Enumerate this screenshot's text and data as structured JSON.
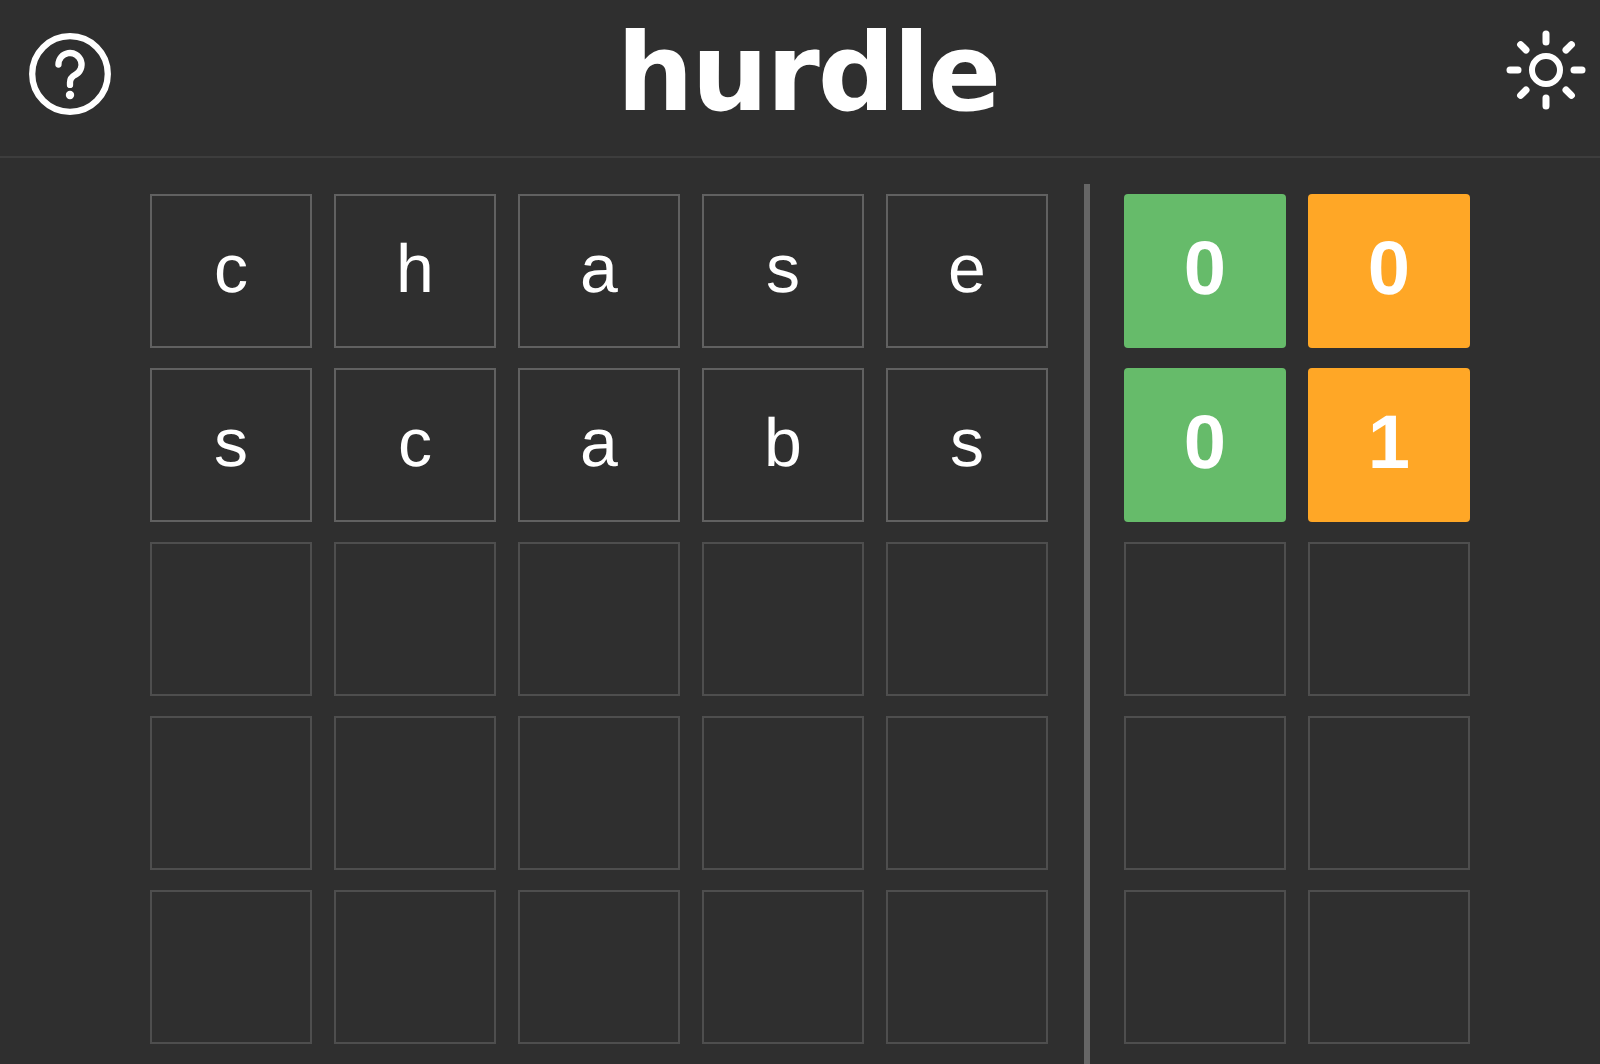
{
  "header": {
    "title": "hurdle"
  },
  "rows": [
    {
      "tiles": [
        {
          "filled": true,
          "letter": "c"
        },
        {
          "filled": true,
          "letter": "h"
        },
        {
          "filled": true,
          "letter": "a"
        },
        {
          "filled": true,
          "letter": "s"
        },
        {
          "filled": true,
          "letter": "e"
        }
      ],
      "scores": [
        {
          "filled": true,
          "kind": "correct",
          "value": "0"
        },
        {
          "filled": true,
          "kind": "present",
          "value": "0"
        }
      ]
    },
    {
      "tiles": [
        {
          "filled": true,
          "letter": "s"
        },
        {
          "filled": true,
          "letter": "c"
        },
        {
          "filled": true,
          "letter": "a"
        },
        {
          "filled": true,
          "letter": "b"
        },
        {
          "filled": true,
          "letter": "s"
        }
      ],
      "scores": [
        {
          "filled": true,
          "kind": "correct",
          "value": "0"
        },
        {
          "filled": true,
          "kind": "present",
          "value": "1"
        }
      ]
    },
    {
      "tiles": [
        {
          "filled": false
        },
        {
          "filled": false
        },
        {
          "filled": false
        },
        {
          "filled": false
        },
        {
          "filled": false
        }
      ],
      "scores": [
        {
          "filled": false
        },
        {
          "filled": false
        }
      ]
    },
    {
      "tiles": [
        {
          "filled": false
        },
        {
          "filled": false
        },
        {
          "filled": false
        },
        {
          "filled": false
        },
        {
          "filled": false
        }
      ],
      "scores": [
        {
          "filled": false
        },
        {
          "filled": false
        }
      ]
    },
    {
      "tiles": [
        {
          "filled": false
        },
        {
          "filled": false
        },
        {
          "filled": false
        },
        {
          "filled": false
        },
        {
          "filled": false
        }
      ],
      "scores": [
        {
          "filled": false
        },
        {
          "filled": false
        }
      ]
    }
  ]
}
